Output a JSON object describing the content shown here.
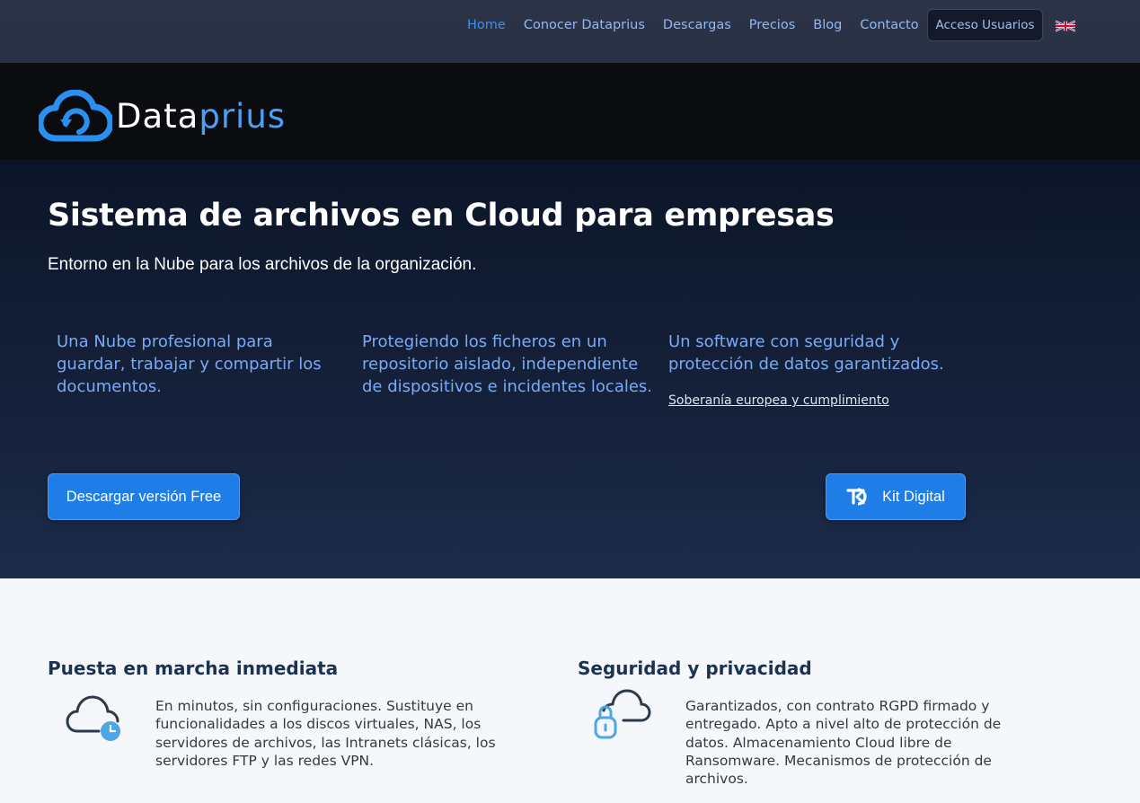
{
  "nav": {
    "links": [
      {
        "label": "Home",
        "active": true
      },
      {
        "label": "Conocer Dataprius",
        "active": false
      },
      {
        "label": "Descargas",
        "active": false
      },
      {
        "label": "Precios",
        "active": false
      },
      {
        "label": "Blog",
        "active": false
      },
      {
        "label": "Contacto",
        "active": false
      }
    ],
    "access_button": "Acceso Usuarios",
    "language_flag_icon": "uk-flag-icon"
  },
  "logo": {
    "part1": "Data",
    "part2": "prius",
    "icon": "cloud-sync-icon"
  },
  "hero": {
    "title": "Sistema de archivos en Cloud para empresas",
    "subtitle": "Entorno en la Nube para los archivos de la organización.",
    "features": [
      "Una Nube profesional para guardar, trabajar y compartir los documentos.",
      "Protegiendo los ficheros en un repositorio aislado, independiente de dispositivos e incidentes locales.",
      "Un software con seguridad y protección de datos garantizados."
    ],
    "link": "Soberanía europea y cumplimiento",
    "download_button": "Descargar versión Free",
    "kit_button": "Kit Digital"
  },
  "section": {
    "columns": [
      {
        "title": "Puesta en marcha inmediata",
        "icon": "cloud-clock-icon",
        "text": "En minutos, sin configuraciones. Sustituye en funcionalidades a los discos virtuales, NAS, los servidores de archivos, las Intranets clásicas, los servidores FTP y las redes VPN."
      },
      {
        "title": "Seguridad y privacidad",
        "icon": "cloud-lock-icon",
        "text": "Garantizados, con contrato RGPD firmado y entregado. Apto a nivel alto de protección de datos. Almacenamiento Cloud libre de Ransomware. Mecanismos de protección de archivos."
      }
    ]
  },
  "colors": {
    "accent": "#1e7de6",
    "nav_bg": "#2e3448",
    "hero_text": "#7aaaf6",
    "section_title": "#1b3350"
  }
}
